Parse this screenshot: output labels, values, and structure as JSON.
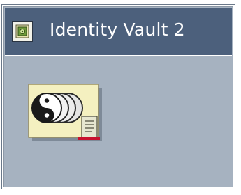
{
  "window": {
    "title": "Identity Vault 2"
  },
  "icons": {
    "title_icon": "vault-small-icon",
    "main_icon": "identity-vault-icon"
  },
  "colors": {
    "titlebar": "#4c607c",
    "panel": "#a6b2c0",
    "icon_card": "#f4f0c0",
    "accent_red": "#c8102e"
  }
}
